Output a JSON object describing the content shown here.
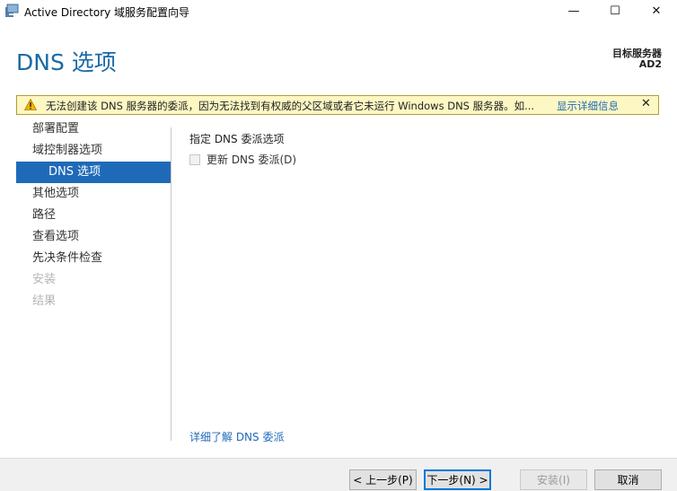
{
  "window": {
    "title": "Active Directory 域服务配置向导",
    "icon": "ad-wizard-icon",
    "minimize_glyph": "—",
    "maximize_glyph": "☐",
    "close_glyph": "✕"
  },
  "header": {
    "page_title": "DNS 选项",
    "target_server_label": "目标服务器",
    "target_server_value": "AD2"
  },
  "warning": {
    "icon": "warning-icon",
    "message": "无法创建该 DNS 服务器的委派，因为无法找到有权威的父区域或者它未运行 Windows DNS 服务器。如...",
    "details_link": "显示详细信息",
    "close_glyph": "✕",
    "colors": {
      "background": "#fdf7c3",
      "border": "#b29c3c"
    }
  },
  "nav": {
    "items": [
      {
        "label": "部署配置",
        "state": "normal"
      },
      {
        "label": "域控制器选项",
        "state": "normal"
      },
      {
        "label": "DNS 选项",
        "state": "active"
      },
      {
        "label": "其他选项",
        "state": "normal"
      },
      {
        "label": "路径",
        "state": "normal"
      },
      {
        "label": "查看选项",
        "state": "normal"
      },
      {
        "label": "先决条件检查",
        "state": "normal"
      },
      {
        "label": "安装",
        "state": "disabled"
      },
      {
        "label": "结果",
        "state": "disabled"
      }
    ],
    "active_color": "#1f6ab8"
  },
  "main": {
    "section_label": "指定 DNS 委派选项",
    "update_delegation": {
      "label": "更新 DNS 委派(D)",
      "checked": false,
      "enabled": false
    },
    "learn_more_link": "详细了解 DNS 委派"
  },
  "footer": {
    "prev_label": "< 上一步(P)",
    "next_label": "下一步(N) >",
    "install_label": "安装(I)",
    "cancel_label": "取消"
  },
  "colors": {
    "accent": "#1a6aa6",
    "link": "#1f6ab8"
  }
}
